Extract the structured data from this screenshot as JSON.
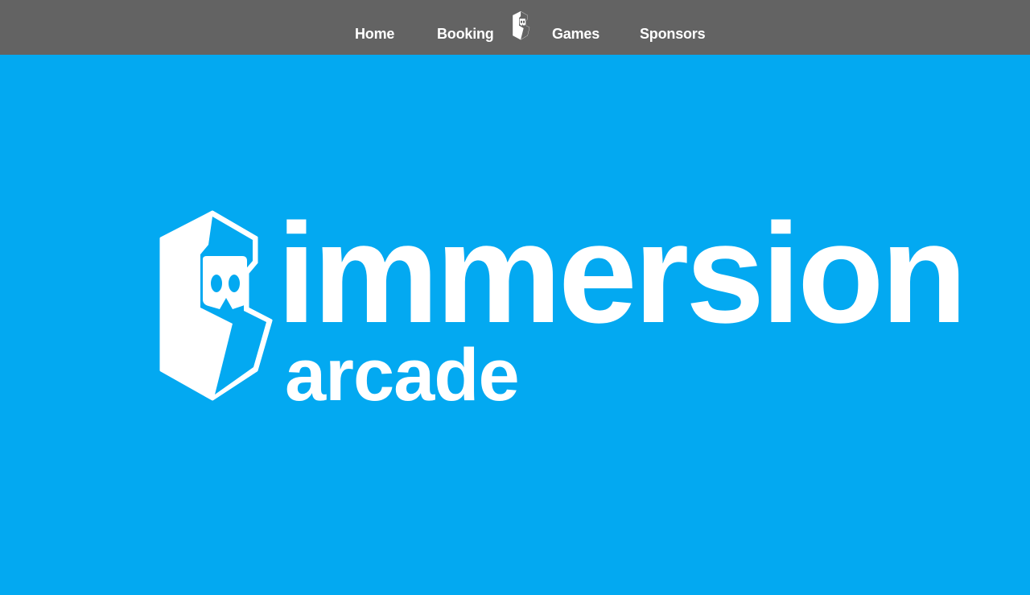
{
  "nav": {
    "items": [
      {
        "label": "Home"
      },
      {
        "label": "Booking"
      },
      {
        "label": "Games"
      },
      {
        "label": "Sponsors"
      }
    ],
    "logo_icon": "arcade-cabinet-vr-icon"
  },
  "hero": {
    "wordmark_main": "immersion",
    "wordmark_sub": "arcade",
    "logo_icon": "arcade-cabinet-vr-icon"
  },
  "colors": {
    "navbar_bg": "#636363",
    "hero_bg": "#03a9f1",
    "text": "#ffffff"
  }
}
